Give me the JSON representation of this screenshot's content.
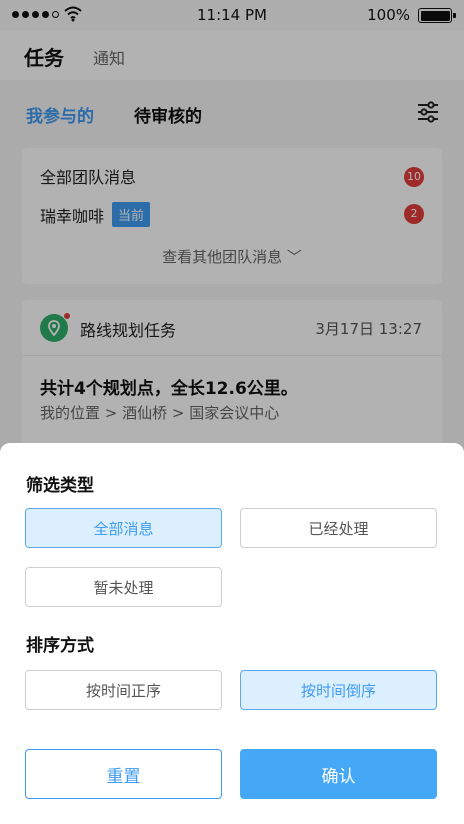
{
  "status_bar": {
    "time": "11:14 PM",
    "battery": "100%"
  },
  "nav": {
    "title": "任务",
    "subtitle": "通知"
  },
  "tabs": {
    "active": "我参与的",
    "other": "待审核的",
    "filter_icon": "sliders-icon"
  },
  "teams": {
    "items": [
      {
        "label": "全部团队消息",
        "badge": "10"
      },
      {
        "label": "瑞幸咖啡",
        "tag": "当前",
        "badge": "2"
      }
    ],
    "see_more": "查看其他团队消息 ﹀"
  },
  "task": {
    "title": "路线规划任务",
    "time": "3月17日 13:27",
    "summary": "共计4个规划点，全长12.6公里。",
    "route": "我的位置 > 酒仙桥 > 国家会议中心",
    "icon": "map-pin-icon"
  },
  "sheet": {
    "filter_title": "筛选类型",
    "filter_options": [
      "全部消息",
      "已经处理",
      "暂未处理"
    ],
    "filter_selected": "全部消息",
    "sort_title": "排序方式",
    "sort_options": [
      "按时间正序",
      "按时间倒序"
    ],
    "sort_selected": "按时间倒序",
    "reset_label": "重置",
    "confirm_label": "确认"
  },
  "colors": {
    "accent": "#3f9bf3",
    "badge": "#e33d3d",
    "selected_bg": "#dcefff"
  }
}
